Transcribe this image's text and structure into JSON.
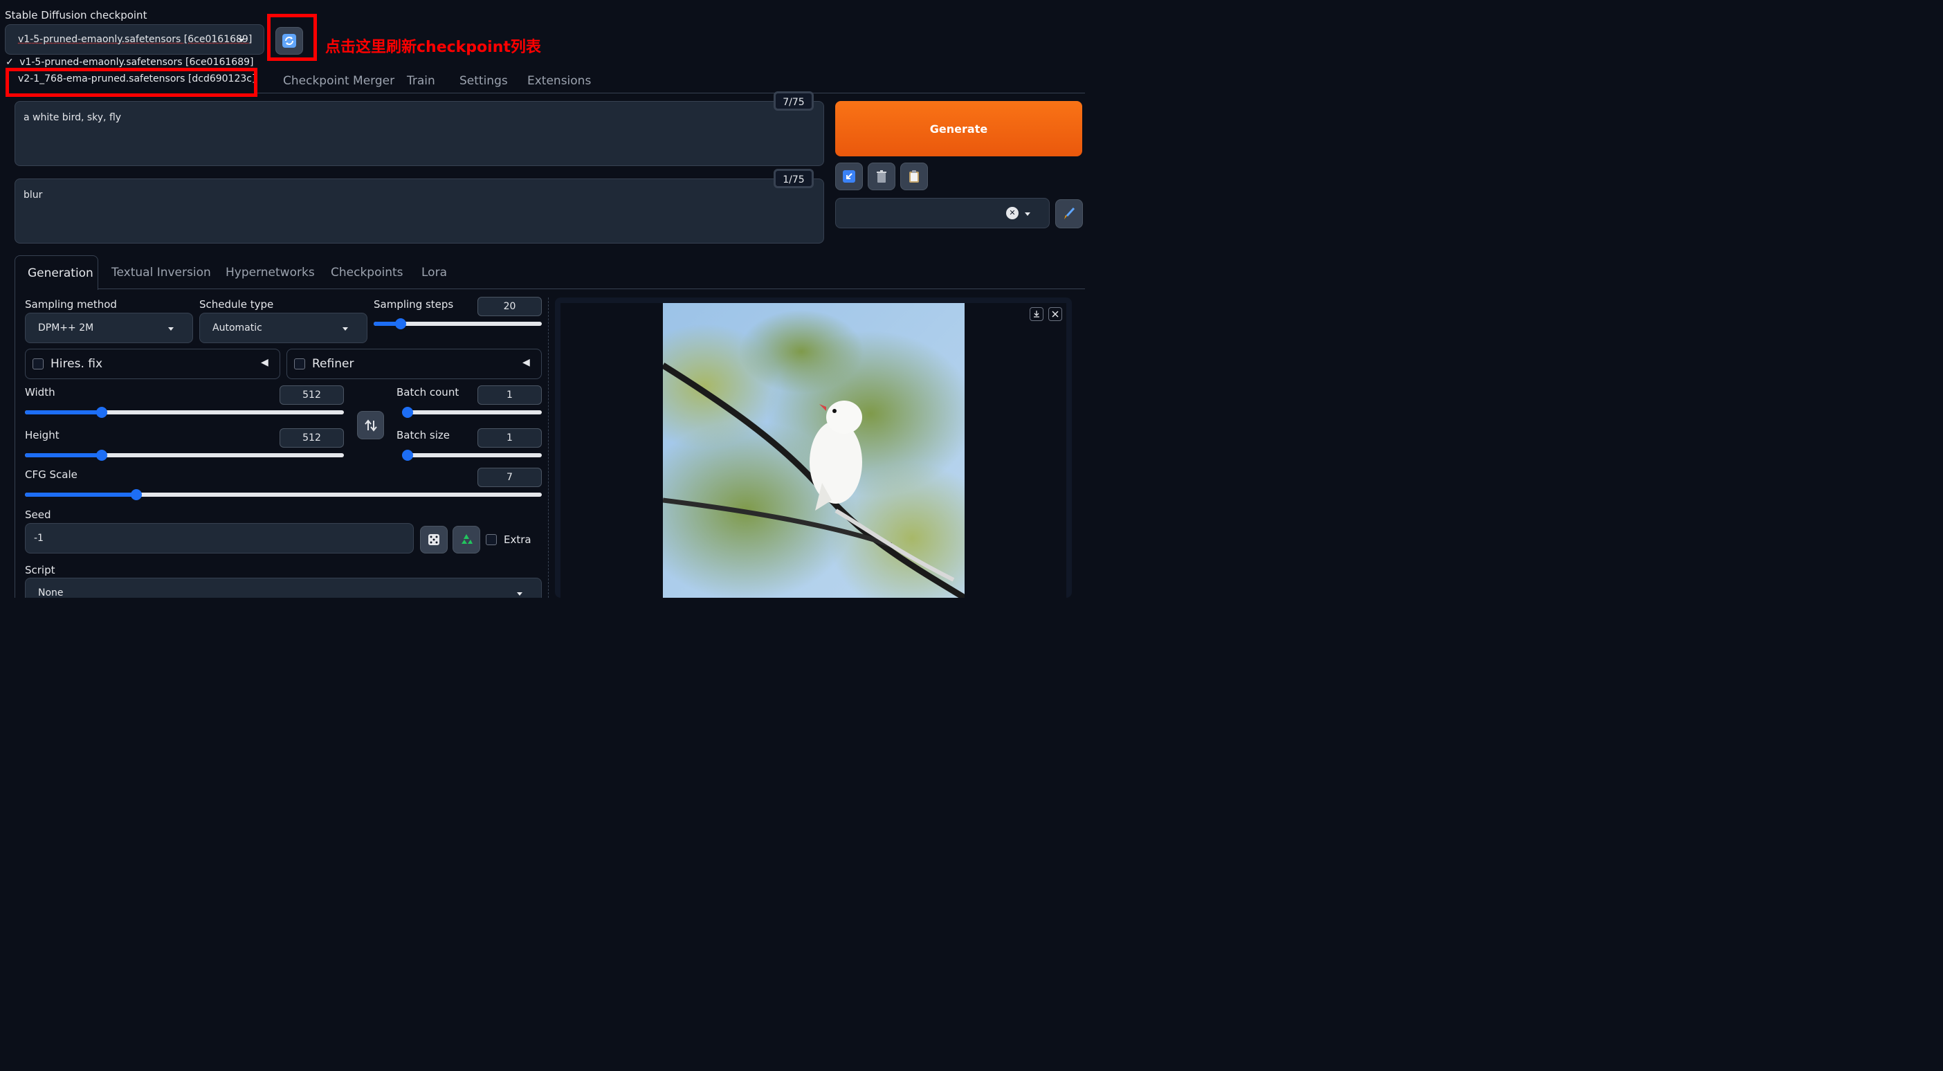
{
  "checkpoint": {
    "label": "Stable Diffusion checkpoint",
    "selected": "v1-5-pruned-emaonly.safetensors [6ce0161689]",
    "options": [
      {
        "label": "v1-5-pruned-emaonly.safetensors [6ce0161689]",
        "checked": true,
        "check_mark": "✓"
      },
      {
        "label": "v2-1_768-ema-pruned.safetensors [dcd690123c]",
        "checked": false
      }
    ]
  },
  "annotation": {
    "text": "点击这里刷新checkpoint列表",
    "color": "#ff0000"
  },
  "top_tabs": [
    "Checkpoint Merger",
    "Train",
    "Settings",
    "Extensions"
  ],
  "prompt": {
    "value": "a white bird, sky, fly",
    "token_count": "7/75"
  },
  "negative_prompt": {
    "value": "blur",
    "token_count": "1/75"
  },
  "generate": {
    "label": "Generate",
    "color": "#f97316"
  },
  "tool_icons": [
    "arrow-in-icon",
    "trash-icon",
    "clipboard-icon",
    "brush-icon"
  ],
  "styles": {
    "clear_icon": "✕"
  },
  "sub_tabs": [
    "Generation",
    "Textual Inversion",
    "Hypernetworks",
    "Checkpoints",
    "Lora"
  ],
  "sampling_method": {
    "label": "Sampling method",
    "value": "DPM++ 2M"
  },
  "schedule_type": {
    "label": "Schedule type",
    "value": "Automatic"
  },
  "sampling_steps": {
    "label": "Sampling steps",
    "value": "20",
    "fraction": 0.16
  },
  "hires_fix": {
    "label": "Hires. fix",
    "arrow": "◀"
  },
  "refiner": {
    "label": "Refiner",
    "arrow": "◀"
  },
  "width": {
    "label": "Width",
    "value": "512",
    "fraction": 0.24
  },
  "height": {
    "label": "Height",
    "value": "512",
    "fraction": 0.24
  },
  "batch_count": {
    "label": "Batch count",
    "value": "1",
    "fraction": 0.0
  },
  "batch_size": {
    "label": "Batch size",
    "value": "1",
    "fraction": 0.0
  },
  "cfg_scale": {
    "label": "CFG Scale",
    "value": "7",
    "fraction": 0.215
  },
  "seed": {
    "label": "Seed",
    "value": "-1",
    "extra_label": "Extra"
  },
  "script": {
    "label": "Script",
    "value": "None"
  }
}
